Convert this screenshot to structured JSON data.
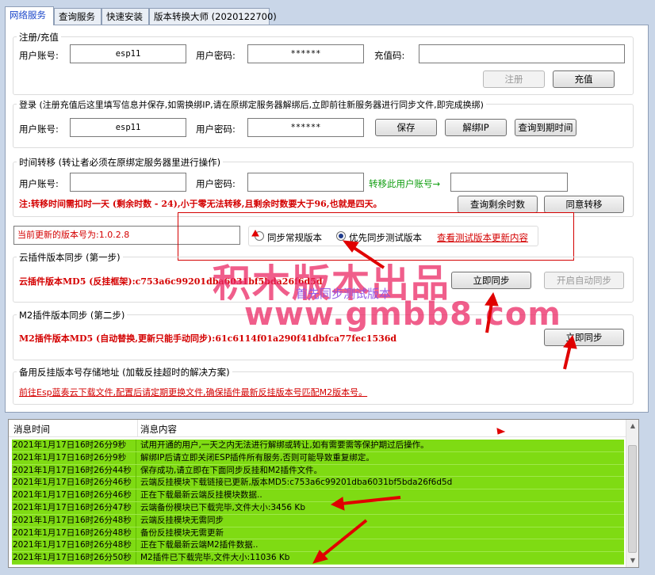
{
  "tabs": [
    "网络服务",
    "查询服务",
    "快速安装",
    "版本转换大师 (2020122700)"
  ],
  "register": {
    "legend": "注册/充值",
    "account_label": "用户账号:",
    "account_value": "esp11",
    "password_label": "用户密码:",
    "password_value": "******",
    "recharge_label": "充值码:",
    "recharge_value": "",
    "register_button": "注册",
    "recharge_button": "充值"
  },
  "login": {
    "legend": "登录 (注册充值后这里填写信息并保存,如需换绑IP,请在原绑定服务器解绑后,立即前往新服务器进行同步文件,即完成换绑)",
    "account_label": "用户账号:",
    "account_value": "esp11",
    "password_label": "用户密码:",
    "password_value": "******",
    "save_button": "保存",
    "unbind_button": "解绑IP",
    "query_button": "查询到期时间"
  },
  "transfer": {
    "legend": "时间转移 (转让者必须在原绑定服务器里进行操作)",
    "account_label": "用户账号:",
    "password_label": "用户密码:",
    "target_label": "转移此用户账号→",
    "note": "注:转移时间需扣时一天 (剩余时数 - 24),小于零无法转移,且剩余时数要大于96,也就是四天。",
    "query_button": "查询剩余时数",
    "agree_button": "同意转移"
  },
  "version": {
    "current": "当前更新的版本号为:1.0.2.8",
    "radio_normal": "同步常规版本",
    "radio_test": "优先同步测试版本",
    "link": "查看测试版本更新内容"
  },
  "cloud": {
    "legend": "云插件版本同步 (第一步)",
    "md5": "云插件版本MD5 (反挂框架):c753a6c99201dba6031bf5bda26f6d5d",
    "sync_button": "立即同步",
    "auto_button": "开启自动同步"
  },
  "m2": {
    "legend": "M2插件版本同步 (第二步)",
    "md5": "M2插件版本MD5 (自动替换,更新只能手动同步):61c6114f01a290f41dbfca77fec1536d",
    "sync_button": "立即同步"
  },
  "backup": {
    "legend": "备用反挂版本号存储地址 (加载反挂超时的解决方案)",
    "link": "前往Esp蓝奏云下载文件,配置后请定期更换文件,确保插件最新反挂版本号匹配M2版本号。"
  },
  "watermark": {
    "line1": "积木版本出品",
    "line2": "首先同步测试版本",
    "line3": "www.gmbb8.com"
  },
  "log": {
    "col_time": "消息时间",
    "col_msg": "消息内容",
    "rows": [
      {
        "time": "2021年1月17日16时26分9秒",
        "msg": "试用开通的用户,一天之内无法进行解绑或转让,如有需要需等保护期过后操作。"
      },
      {
        "time": "2021年1月17日16时26分9秒",
        "msg": "解绑IP后请立即关闭ESP插件所有服务,否则可能导致重复绑定。"
      },
      {
        "time": "2021年1月17日16时26分44秒",
        "msg": "保存成功,请立即在下面同步反挂和M2插件文件。"
      },
      {
        "time": "2021年1月17日16时26分46秒",
        "msg": "云端反挂模块下载链接已更新,版本MD5:c753a6c99201dba6031bf5bda26f6d5d"
      },
      {
        "time": "2021年1月17日16时26分46秒",
        "msg": "正在下载最新云端反挂模块数据.."
      },
      {
        "time": "2021年1月17日16时26分47秒",
        "msg": "云端备份模块已下载完毕,文件大小:3456 Kb"
      },
      {
        "time": "2021年1月17日16时26分48秒",
        "msg": "云端反挂模块无需同步"
      },
      {
        "time": "2021年1月17日16时26分48秒",
        "msg": "备份反挂模块无需更新"
      },
      {
        "time": "2021年1月17日16时26分48秒",
        "msg": "正在下载最新云端M2插件数据.."
      },
      {
        "time": "2021年1月17日16时26分50秒",
        "msg": "M2插件已下载完毕,文件大小:11036 Kb"
      }
    ]
  },
  "colors": {
    "annotation_red": "#e00000",
    "row_green": "#7fdb13",
    "tab_blue": "#1b46c9"
  }
}
